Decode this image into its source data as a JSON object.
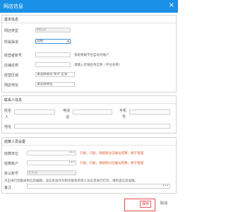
{
  "window": {
    "title": "网店信息",
    "close_glyph": "×"
  },
  "basic": {
    "section_title": "基本信息",
    "shop_type": {
      "label": "网店类型",
      "value": "微信店"
    },
    "shop_select": {
      "label": "所属渠道",
      "value": "选择"
    },
    "principal": {
      "label": "经营者账号",
      "hint": "系统根据平台自动为账户"
    },
    "shop_name": {
      "label": "店铺名称",
      "hint": "请输入店铺名称全称（平台名称）"
    },
    "address": {
      "label": "经营区域",
      "value": "请选择省份 地市 区县"
    },
    "shop_url": {
      "label": "网店地址",
      "value": "请选择地址"
    }
  },
  "contact": {
    "section_title": "联系人信息",
    "name_label": "姓名",
    "name_label2": "人",
    "phone_label": "电话",
    "phone_label2": "话",
    "mobile_label": "手机",
    "mobile_label2": "号",
    "addr_label": "地址"
  },
  "settlement": {
    "section_title": "结算人员设置",
    "unit": {
      "label": "结算单位",
      "hint": "只能，只能，请按照分店编号结算，便于管理"
    },
    "account": {
      "label": "结算账户",
      "hint": "只能，只能，请按照分店编号结算，便于管理"
    },
    "default": {
      "label": "默认账号",
      "value": "北京店"
    },
    "note": "点击进行后勤采购信息编辑，该信息会作为物流联系单或人员信息进行打印，请检查信息准确。",
    "remark_label": "备注"
  },
  "footer": {
    "save_label": "保存",
    "cancel_label": "取消"
  },
  "colors": {
    "titlebar": "#1a90e6",
    "hint_red": "#e05a2b",
    "save_border": "#f25d5d"
  }
}
